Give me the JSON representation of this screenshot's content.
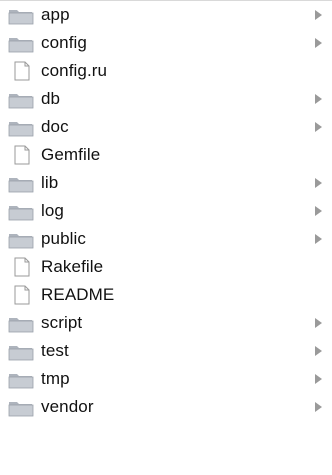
{
  "items": [
    {
      "label": "app",
      "kind": "folder"
    },
    {
      "label": "config",
      "kind": "folder"
    },
    {
      "label": "config.ru",
      "kind": "file"
    },
    {
      "label": "db",
      "kind": "folder"
    },
    {
      "label": "doc",
      "kind": "folder"
    },
    {
      "label": "Gemfile",
      "kind": "file"
    },
    {
      "label": "lib",
      "kind": "folder"
    },
    {
      "label": "log",
      "kind": "folder"
    },
    {
      "label": "public",
      "kind": "folder"
    },
    {
      "label": "Rakefile",
      "kind": "file"
    },
    {
      "label": "README",
      "kind": "file"
    },
    {
      "label": "script",
      "kind": "folder"
    },
    {
      "label": "test",
      "kind": "folder"
    },
    {
      "label": "tmp",
      "kind": "folder"
    },
    {
      "label": "vendor",
      "kind": "folder"
    }
  ],
  "icons": {
    "folder": "folder-icon",
    "file": "document-icon",
    "disclosure": "disclosure-triangle-icon"
  },
  "colors": {
    "text": "#111111",
    "folder_body": "#c7ccd3",
    "folder_tab": "#aeb4bd",
    "file_outline": "#9a9a9a",
    "disclosure": "#9a9a9a"
  }
}
